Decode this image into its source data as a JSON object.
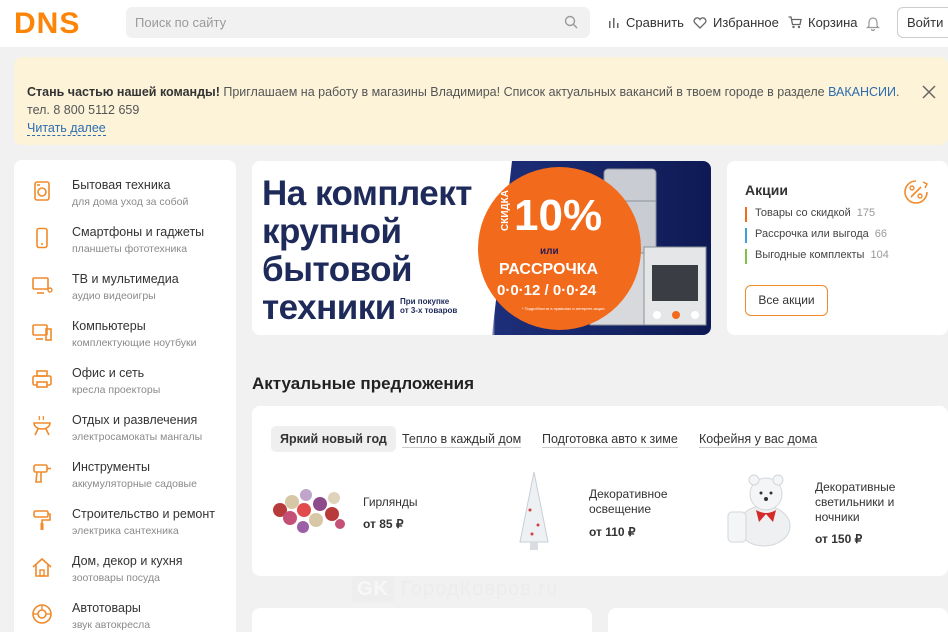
{
  "header": {
    "logo": "DNS",
    "search_placeholder": "Поиск по сайту",
    "nav": [
      "Сравнить",
      "Избранное",
      "Корзина"
    ],
    "login": "Войти"
  },
  "notice": {
    "bold": "Стань частью нашей команды!",
    "text": " Приглашаем на работу в магазины Владимира! Список актуальных вакансий в твоем городе в разделе ",
    "link": "ВАКАНСИИ",
    "tail": ". тел. 8 800 5112 659",
    "more": "Читать далее"
  },
  "sidebar": {
    "items": [
      {
        "title": "Бытовая техника",
        "sub": "для дома   уход за собой",
        "icon": "appliance-icon"
      },
      {
        "title": "Смартфоны и гаджеты",
        "sub": "планшеты   фототехника",
        "icon": "smartphone-icon"
      },
      {
        "title": "ТВ и мультимедиа",
        "sub": "аудио   видеоигры",
        "icon": "tv-icon"
      },
      {
        "title": "Компьютеры",
        "sub": "комплектующие   ноутбуки",
        "icon": "computer-icon"
      },
      {
        "title": "Офис и сеть",
        "sub": "кресла   проекторы",
        "icon": "printer-icon"
      },
      {
        "title": "Отдых и развлечения",
        "sub": "электросамокаты   мангалы",
        "icon": "grill-icon"
      },
      {
        "title": "Инструменты",
        "sub": "аккумуляторные   садовые",
        "icon": "drill-icon"
      },
      {
        "title": "Строительство и ремонт",
        "sub": "электрика   сантехника",
        "icon": "paint-roller-icon"
      },
      {
        "title": "Дом, декор и кухня",
        "sub": "зоотовары   посуда",
        "icon": "home-icon"
      },
      {
        "title": "Автотовары",
        "sub": "звук   автокресла",
        "icon": "wheel-icon"
      }
    ]
  },
  "promo": {
    "headline_1": "На комплект",
    "headline_2": "крупной",
    "headline_3": "бытовой",
    "headline_4": "техники",
    "note_1": "При покупке",
    "note_2": "от 3-х товаров",
    "vertical": "СКИДКА",
    "percent": "10%",
    "or": "или",
    "installment": "РАССРОЧКА",
    "terms": "0·0·12 / 0·0·24",
    "fine": "* Подробности в правилах и интернет-акции"
  },
  "actions": {
    "title": "Акции",
    "items": [
      {
        "label": "Товары со скидкой",
        "count": "175",
        "color": "#f26a1b"
      },
      {
        "label": "Рассрочка или выгода",
        "count": "66",
        "color": "#3aa0e0"
      },
      {
        "label": "Выгодные комплекты",
        "count": "104",
        "color": "#7cc443"
      }
    ],
    "button": "Все акции"
  },
  "offers": {
    "title": "Актуальные предложения",
    "tabs": [
      "Яркий новый год",
      "Тепло в каждый дом",
      "Подготовка авто к зиме",
      "Кофейня у вас дома"
    ],
    "products": [
      {
        "name_1": "Гирлянды",
        "name_2": "",
        "name_3": "",
        "price": "от 85 ₽"
      },
      {
        "name_1": "Декоративное",
        "name_2": "освещение",
        "name_3": "",
        "price": "от 110 ₽"
      },
      {
        "name_1": "Декоративные",
        "name_2": "светильники и",
        "name_3": "ночники",
        "price": "от 150 ₽"
      }
    ]
  },
  "watermark": {
    "badge": "GK",
    "text": "ГородКовров.ru"
  },
  "colors": {
    "brand": "#fc8507",
    "accent": "#f26a1b",
    "promo_dark": "#1e2a5a"
  }
}
